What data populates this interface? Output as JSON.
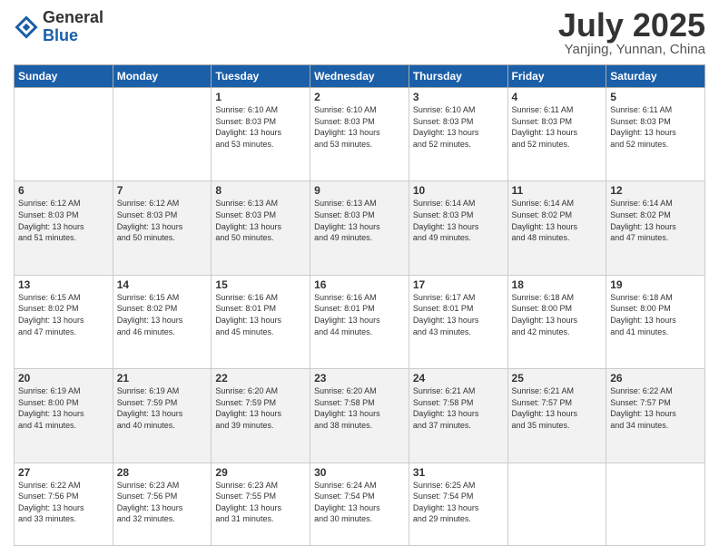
{
  "logo": {
    "general": "General",
    "blue": "Blue"
  },
  "title": "July 2025",
  "subtitle": "Yanjing, Yunnan, China",
  "weekdays": [
    "Sunday",
    "Monday",
    "Tuesday",
    "Wednesday",
    "Thursday",
    "Friday",
    "Saturday"
  ],
  "weeks": [
    [
      {
        "day": "",
        "info": ""
      },
      {
        "day": "",
        "info": ""
      },
      {
        "day": "1",
        "info": "Sunrise: 6:10 AM\nSunset: 8:03 PM\nDaylight: 13 hours\nand 53 minutes."
      },
      {
        "day": "2",
        "info": "Sunrise: 6:10 AM\nSunset: 8:03 PM\nDaylight: 13 hours\nand 53 minutes."
      },
      {
        "day": "3",
        "info": "Sunrise: 6:10 AM\nSunset: 8:03 PM\nDaylight: 13 hours\nand 52 minutes."
      },
      {
        "day": "4",
        "info": "Sunrise: 6:11 AM\nSunset: 8:03 PM\nDaylight: 13 hours\nand 52 minutes."
      },
      {
        "day": "5",
        "info": "Sunrise: 6:11 AM\nSunset: 8:03 PM\nDaylight: 13 hours\nand 52 minutes."
      }
    ],
    [
      {
        "day": "6",
        "info": "Sunrise: 6:12 AM\nSunset: 8:03 PM\nDaylight: 13 hours\nand 51 minutes."
      },
      {
        "day": "7",
        "info": "Sunrise: 6:12 AM\nSunset: 8:03 PM\nDaylight: 13 hours\nand 50 minutes."
      },
      {
        "day": "8",
        "info": "Sunrise: 6:13 AM\nSunset: 8:03 PM\nDaylight: 13 hours\nand 50 minutes."
      },
      {
        "day": "9",
        "info": "Sunrise: 6:13 AM\nSunset: 8:03 PM\nDaylight: 13 hours\nand 49 minutes."
      },
      {
        "day": "10",
        "info": "Sunrise: 6:14 AM\nSunset: 8:03 PM\nDaylight: 13 hours\nand 49 minutes."
      },
      {
        "day": "11",
        "info": "Sunrise: 6:14 AM\nSunset: 8:02 PM\nDaylight: 13 hours\nand 48 minutes."
      },
      {
        "day": "12",
        "info": "Sunrise: 6:14 AM\nSunset: 8:02 PM\nDaylight: 13 hours\nand 47 minutes."
      }
    ],
    [
      {
        "day": "13",
        "info": "Sunrise: 6:15 AM\nSunset: 8:02 PM\nDaylight: 13 hours\nand 47 minutes."
      },
      {
        "day": "14",
        "info": "Sunrise: 6:15 AM\nSunset: 8:02 PM\nDaylight: 13 hours\nand 46 minutes."
      },
      {
        "day": "15",
        "info": "Sunrise: 6:16 AM\nSunset: 8:01 PM\nDaylight: 13 hours\nand 45 minutes."
      },
      {
        "day": "16",
        "info": "Sunrise: 6:16 AM\nSunset: 8:01 PM\nDaylight: 13 hours\nand 44 minutes."
      },
      {
        "day": "17",
        "info": "Sunrise: 6:17 AM\nSunset: 8:01 PM\nDaylight: 13 hours\nand 43 minutes."
      },
      {
        "day": "18",
        "info": "Sunrise: 6:18 AM\nSunset: 8:00 PM\nDaylight: 13 hours\nand 42 minutes."
      },
      {
        "day": "19",
        "info": "Sunrise: 6:18 AM\nSunset: 8:00 PM\nDaylight: 13 hours\nand 41 minutes."
      }
    ],
    [
      {
        "day": "20",
        "info": "Sunrise: 6:19 AM\nSunset: 8:00 PM\nDaylight: 13 hours\nand 41 minutes."
      },
      {
        "day": "21",
        "info": "Sunrise: 6:19 AM\nSunset: 7:59 PM\nDaylight: 13 hours\nand 40 minutes."
      },
      {
        "day": "22",
        "info": "Sunrise: 6:20 AM\nSunset: 7:59 PM\nDaylight: 13 hours\nand 39 minutes."
      },
      {
        "day": "23",
        "info": "Sunrise: 6:20 AM\nSunset: 7:58 PM\nDaylight: 13 hours\nand 38 minutes."
      },
      {
        "day": "24",
        "info": "Sunrise: 6:21 AM\nSunset: 7:58 PM\nDaylight: 13 hours\nand 37 minutes."
      },
      {
        "day": "25",
        "info": "Sunrise: 6:21 AM\nSunset: 7:57 PM\nDaylight: 13 hours\nand 35 minutes."
      },
      {
        "day": "26",
        "info": "Sunrise: 6:22 AM\nSunset: 7:57 PM\nDaylight: 13 hours\nand 34 minutes."
      }
    ],
    [
      {
        "day": "27",
        "info": "Sunrise: 6:22 AM\nSunset: 7:56 PM\nDaylight: 13 hours\nand 33 minutes."
      },
      {
        "day": "28",
        "info": "Sunrise: 6:23 AM\nSunset: 7:56 PM\nDaylight: 13 hours\nand 32 minutes."
      },
      {
        "day": "29",
        "info": "Sunrise: 6:23 AM\nSunset: 7:55 PM\nDaylight: 13 hours\nand 31 minutes."
      },
      {
        "day": "30",
        "info": "Sunrise: 6:24 AM\nSunset: 7:54 PM\nDaylight: 13 hours\nand 30 minutes."
      },
      {
        "day": "31",
        "info": "Sunrise: 6:25 AM\nSunset: 7:54 PM\nDaylight: 13 hours\nand 29 minutes."
      },
      {
        "day": "",
        "info": ""
      },
      {
        "day": "",
        "info": ""
      }
    ]
  ]
}
